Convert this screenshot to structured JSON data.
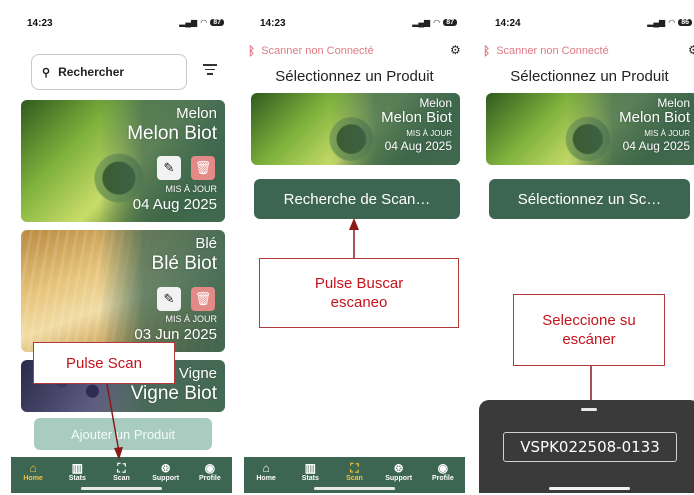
{
  "status": {
    "s1_time": "14:23",
    "s2_time": "14:23",
    "s3_time": "14:24",
    "battery": "87",
    "battery3": "86"
  },
  "screen1": {
    "search_placeholder": "Rechercher",
    "cards": [
      {
        "category": "Melon",
        "name": "Melon Biot",
        "updated_label": "MIS À JOUR",
        "date": "04 Aug 2025"
      },
      {
        "category": "Blé",
        "name": "Blé Biot",
        "updated_label": "MIS À JOUR",
        "date": "03 Jun 2025"
      },
      {
        "category": "Vigne",
        "name": "Vigne Biot"
      }
    ],
    "add_button": "Ajouter un Produit",
    "callout": "Pulse Scan"
  },
  "tabs": [
    {
      "label": "Home",
      "icon": "home-icon"
    },
    {
      "label": "Stats",
      "icon": "bar-chart-icon"
    },
    {
      "label": "Scan",
      "icon": "scan-icon"
    },
    {
      "label": "Support",
      "icon": "support-icon"
    },
    {
      "label": "Profile",
      "icon": "profile-icon"
    }
  ],
  "screen2": {
    "scanner_status": "Scanner non Connecté",
    "title": "Sélectionnez un Produit",
    "card": {
      "category": "Melon",
      "name": "Melon Biot",
      "updated_label": "MIS À JOUR",
      "date": "04 Aug 2025"
    },
    "button": "Recherche de Scan…",
    "callout": "Pulse Buscar escaneo"
  },
  "screen3": {
    "scanner_status": "Scanner non Connecté",
    "title": "Sélectionnez un Produit",
    "card": {
      "category": "Melon",
      "name": "Melon Biot",
      "updated_label": "MIS À JOUR",
      "date": "04 Aug 2025"
    },
    "button": "Sélectionnez un Sc…",
    "callout": "Seleccione su escáner",
    "scanner_name": "VSPK022508-0133"
  },
  "colors": {
    "brand_green": "#3d6652",
    "active_tab": "#f3c33c",
    "disconnected": "#e07a86",
    "callout_red": "#c4141c"
  }
}
